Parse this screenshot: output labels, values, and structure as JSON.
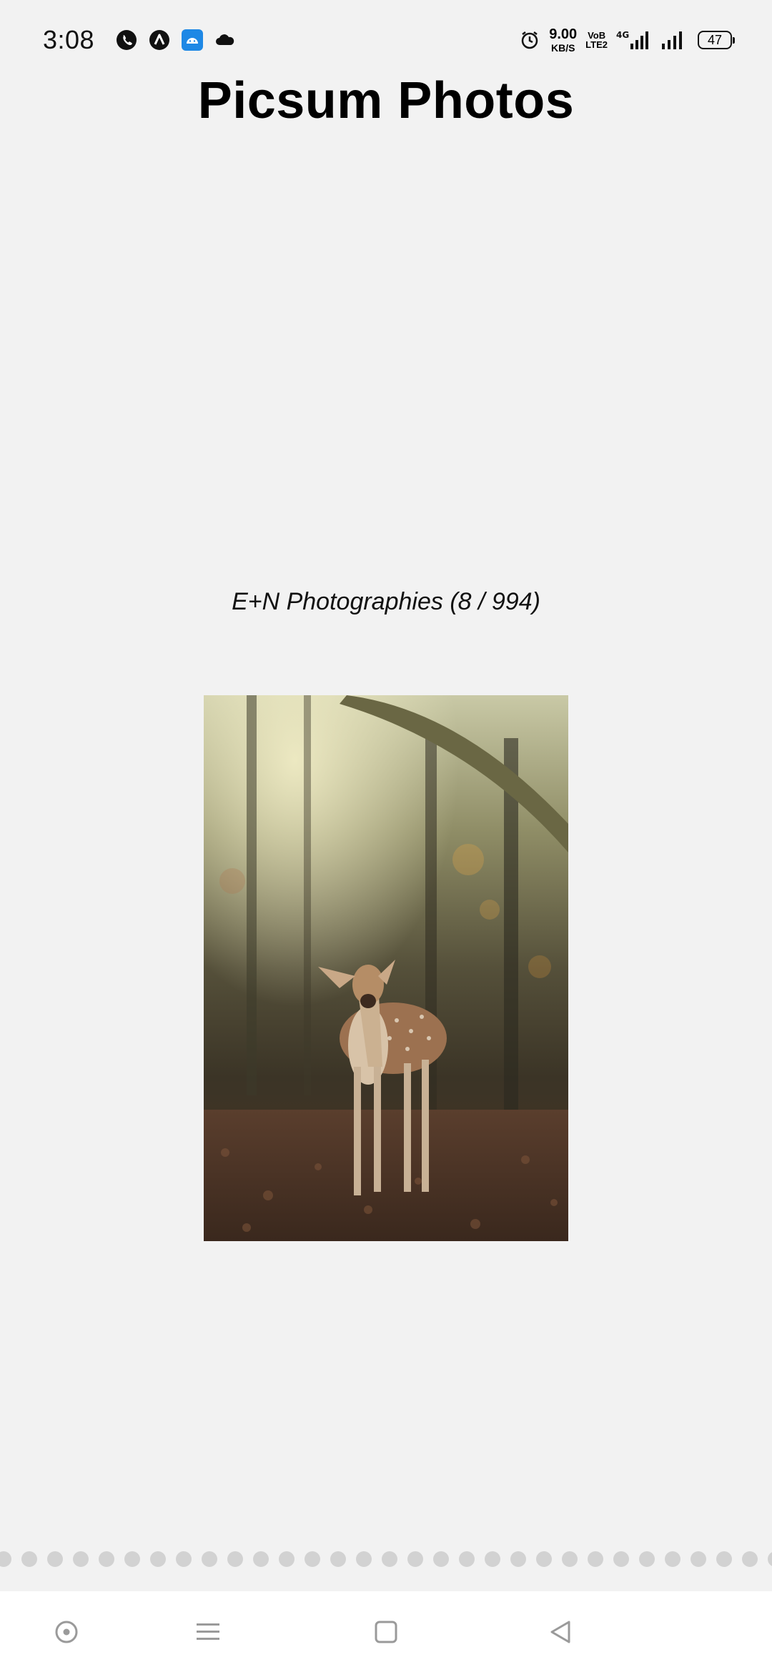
{
  "status_bar": {
    "time": "3:08",
    "notification_icons": [
      "whatsapp-icon",
      "arc-icon",
      "android-app-icon",
      "cloud-icon"
    ],
    "alarm_icon": "alarm-icon",
    "network_speed_value": "9.00",
    "network_speed_unit": "KB/S",
    "volte_top": "VoB",
    "volte_bottom": "LTE2",
    "network_type": "4G",
    "battery_level": "47"
  },
  "app": {
    "title": "Picsum Photos",
    "caption": "E+N Photographies  (8 / 994)",
    "photo": {
      "subject": "fawn-in-forest-photo"
    },
    "pager": {
      "dot_color": "#d2d2d2"
    }
  },
  "nav_bar": {
    "buttons": [
      "assistant-icon",
      "menu-icon",
      "home-icon",
      "back-icon"
    ]
  },
  "colors": {
    "background": "#f2f2f2",
    "nav_background": "#ffffff"
  }
}
